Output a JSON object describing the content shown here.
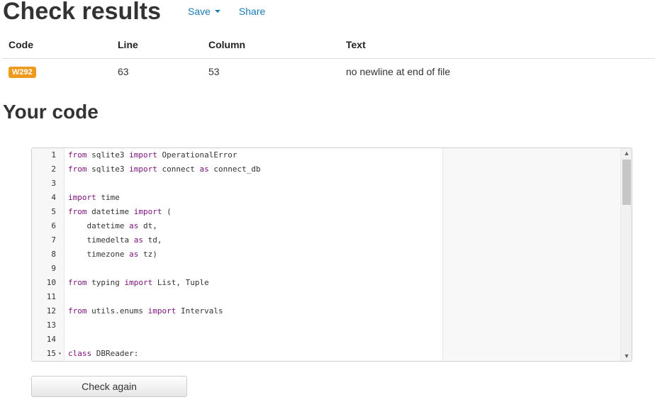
{
  "header": {
    "title": "Check results",
    "save_label": "Save",
    "share_label": "Share"
  },
  "results": {
    "columns": [
      "Code",
      "Line",
      "Column",
      "Text"
    ],
    "rows": [
      {
        "code": "W292",
        "line": "63",
        "column": "53",
        "text": "no newline at end of file"
      }
    ]
  },
  "code_section": {
    "title": "Your code"
  },
  "editor": {
    "lines": [
      {
        "num": "1",
        "tokens": [
          {
            "t": "from",
            "kw": true
          },
          {
            "t": " sqlite3 "
          },
          {
            "t": "import",
            "kw": true
          },
          {
            "t": " OperationalError"
          }
        ]
      },
      {
        "num": "2",
        "tokens": [
          {
            "t": "from",
            "kw": true
          },
          {
            "t": " sqlite3 "
          },
          {
            "t": "import",
            "kw": true
          },
          {
            "t": " connect "
          },
          {
            "t": "as",
            "kw": true
          },
          {
            "t": " connect_db"
          }
        ]
      },
      {
        "num": "3",
        "tokens": []
      },
      {
        "num": "4",
        "tokens": [
          {
            "t": "import",
            "kw": true
          },
          {
            "t": " time"
          }
        ]
      },
      {
        "num": "5",
        "tokens": [
          {
            "t": "from",
            "kw": true
          },
          {
            "t": " datetime "
          },
          {
            "t": "import",
            "kw": true
          },
          {
            "t": " ("
          }
        ]
      },
      {
        "num": "6",
        "tokens": [
          {
            "t": "    datetime "
          },
          {
            "t": "as",
            "kw": true
          },
          {
            "t": " dt,"
          }
        ]
      },
      {
        "num": "7",
        "tokens": [
          {
            "t": "    timedelta "
          },
          {
            "t": "as",
            "kw": true
          },
          {
            "t": " td,"
          }
        ]
      },
      {
        "num": "8",
        "tokens": [
          {
            "t": "    timezone "
          },
          {
            "t": "as",
            "kw": true
          },
          {
            "t": " tz)"
          }
        ]
      },
      {
        "num": "9",
        "tokens": []
      },
      {
        "num": "10",
        "tokens": [
          {
            "t": "from",
            "kw": true
          },
          {
            "t": " typing "
          },
          {
            "t": "import",
            "kw": true
          },
          {
            "t": " List, Tuple"
          }
        ]
      },
      {
        "num": "11",
        "tokens": []
      },
      {
        "num": "12",
        "tokens": [
          {
            "t": "from",
            "kw": true
          },
          {
            "t": " utils.enums "
          },
          {
            "t": "import",
            "kw": true
          },
          {
            "t": " Intervals"
          }
        ]
      },
      {
        "num": "13",
        "tokens": []
      },
      {
        "num": "14",
        "tokens": []
      },
      {
        "num": "15",
        "fold": true,
        "tokens": [
          {
            "t": "class",
            "kw": true
          },
          {
            "t": " DBReader:"
          }
        ]
      }
    ]
  },
  "actions": {
    "check_again_label": "Check again"
  },
  "colors": {
    "link": "#1a7ab8",
    "badge": "#ee9a1e",
    "keyword": "#7a0e7a"
  }
}
